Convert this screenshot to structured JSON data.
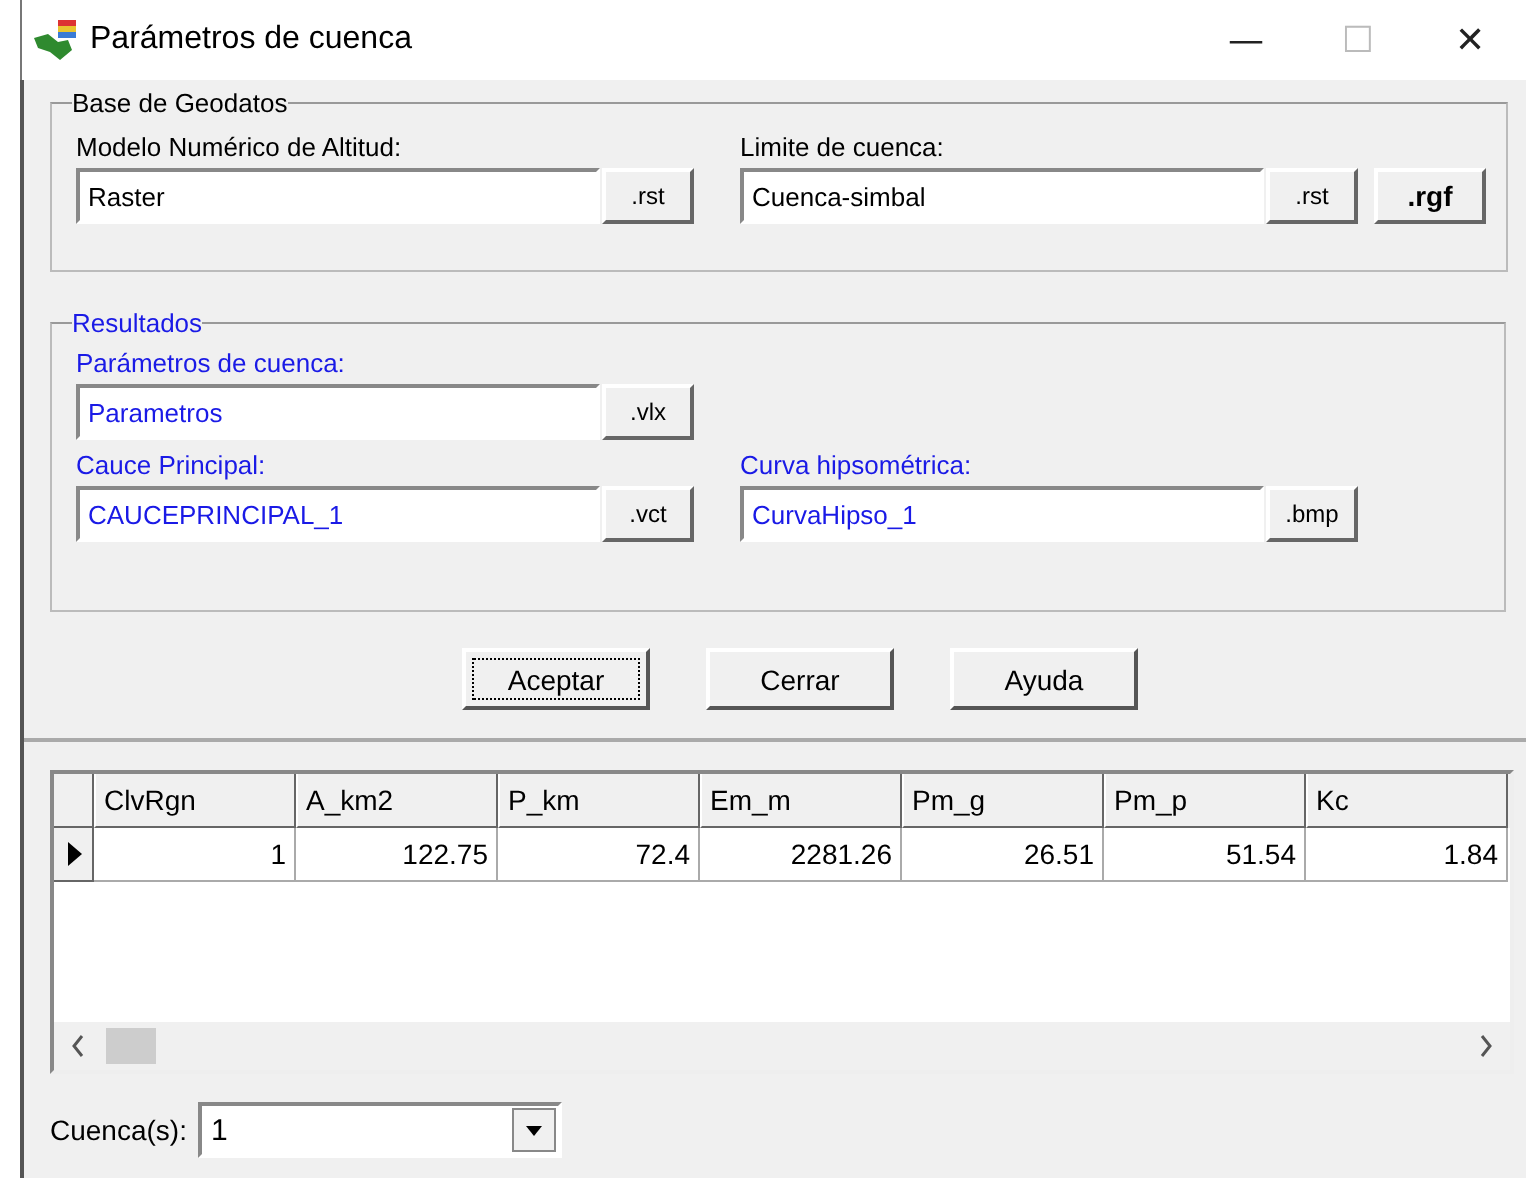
{
  "window": {
    "title": "Parámetros de cuenca",
    "controls": [
      "—",
      "☐",
      "✕"
    ]
  },
  "base_group": {
    "title": "Base de Geodatos",
    "mdt": {
      "label": "Modelo Numérico de Altitud:",
      "value": "Raster",
      "buttons": [
        ".rst"
      ]
    },
    "limit": {
      "label": "Limite de cuenca:",
      "value": "Cuenca-simbal",
      "buttons": [
        ".rst",
        ".rgf"
      ]
    }
  },
  "results_group": {
    "title": "Resultados",
    "params": {
      "label": "Parámetros de cuenca:",
      "value": "Parametros",
      "button": ".vlx"
    },
    "channel": {
      "label": "Cauce Principal:",
      "value": "CAUCEPRINCIPAL_1",
      "button": ".vct"
    },
    "curve": {
      "label": "Curva hipsométrica:",
      "value": "CurvaHipso_1",
      "button": ".bmp"
    }
  },
  "buttons": [
    {
      "label": "Aceptar",
      "focused": true
    },
    {
      "label": "Cerrar",
      "focused": false
    },
    {
      "label": "Ayuda",
      "focused": false
    }
  ],
  "table": {
    "columns": [
      "ClvRgn",
      "A_km2",
      "P_km",
      "Em_m",
      "Pm_g",
      "Pm_p",
      "Kc"
    ],
    "rows": [
      {
        "current": true,
        "cells": [
          "1",
          "122.75",
          "72.4",
          "2281.26",
          "26.51",
          "51.54",
          "1.84"
        ]
      }
    ]
  },
  "basin_select": {
    "label": "Cuenca(s):",
    "value": "1"
  }
}
